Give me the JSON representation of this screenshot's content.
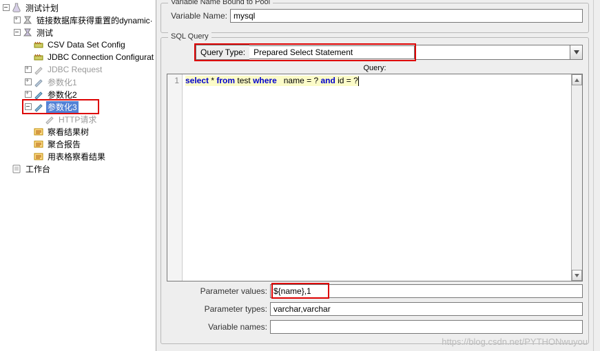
{
  "tree": {
    "root": "测试计划",
    "items": [
      "链接数据库获得重置的dynamic·",
      "测试",
      "CSV Data Set Config",
      "JDBC Connection Configurat",
      "JDBC Request",
      "参数化1",
      "参数化2",
      "参数化3",
      "HTTP请求",
      "察看结果树",
      "聚合报告",
      "用表格察看结果"
    ],
    "workbench": "工作台"
  },
  "panel": {
    "var_section_title": "Variable Name Bound to Pool",
    "var_name_label": "Variable Name:",
    "var_name_value": "mysql",
    "sql_section_title": "SQL Query",
    "query_type_label": "Query Type:",
    "query_type_value": "Prepared Select Statement",
    "query_label": "Query:",
    "sql_kw1": "select",
    "sql_op1": " * ",
    "sql_kw2": "from",
    "sql_tbl": " test ",
    "sql_kw3": "where",
    "sql_mid": "   name = ? ",
    "sql_kw4": "and",
    "sql_tail": " id = ?",
    "line_no": "1",
    "param_values_label": "Parameter values:",
    "param_values_value": "${name},1",
    "param_types_label": "Parameter types:",
    "param_types_value": "varchar,varchar",
    "var_names_label": "Variable names:",
    "var_names_value": ""
  },
  "watermark": "https://blog.csdn.net/PYTHONwuyou"
}
